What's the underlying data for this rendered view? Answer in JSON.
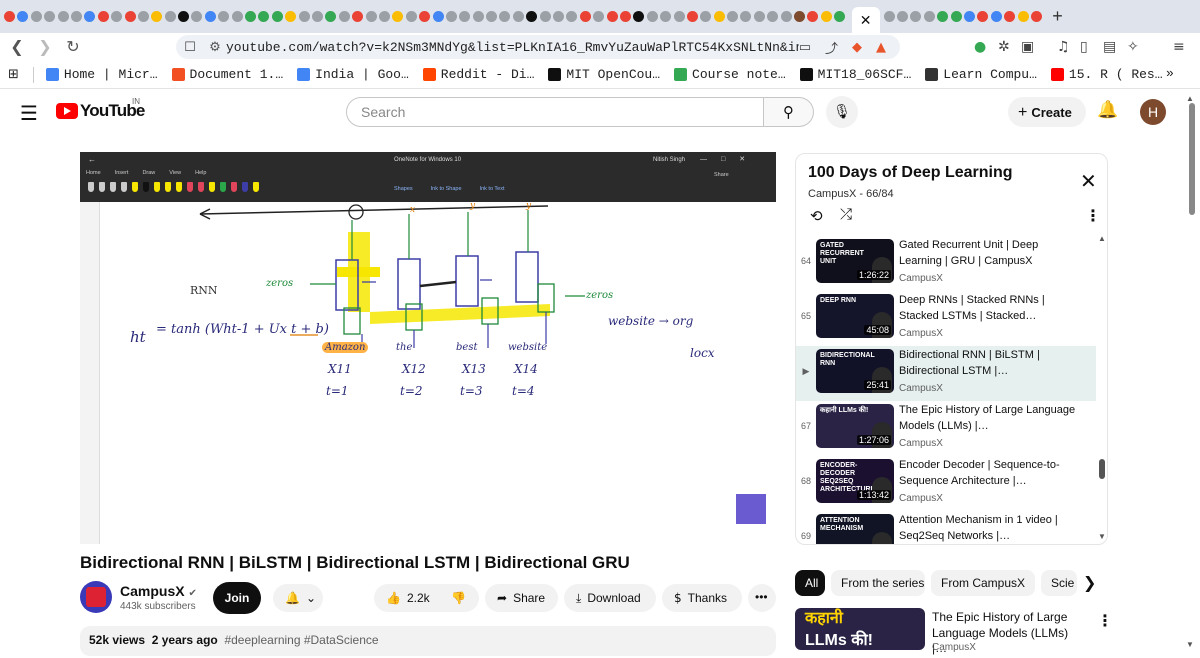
{
  "browser": {
    "tab_favicon_colors": [
      "#ea4335",
      "#4285f4",
      "#9aa0a6",
      "#9aa0a6",
      "#9aa0a6",
      "#9aa0a6",
      "#4285f4",
      "#ea4335",
      "#9aa0a6",
      "#ea4335",
      "#9aa0a6",
      "#fbbc04",
      "#9aa0a6",
      "#0f0f0f",
      "#9aa0a6",
      "#4285f4",
      "#9aa0a6",
      "#9aa0a6",
      "#34a853",
      "#34a853",
      "#34a853",
      "#fbbc04",
      "#9aa0a6",
      "#9aa0a6",
      "#34a853",
      "#9aa0a6",
      "#ea4335",
      "#9aa0a6",
      "#9aa0a6",
      "#fbbc04",
      "#9aa0a6",
      "#ea4335",
      "#4285f4",
      "#9aa0a6",
      "#9aa0a6",
      "#9aa0a6",
      "#9aa0a6",
      "#9aa0a6",
      "#9aa0a6",
      "#0f0f0f",
      "#9aa0a6",
      "#9aa0a6",
      "#9aa0a6",
      "#ea4335",
      "#9aa0a6",
      "#ea4335",
      "#ea4335",
      "#0f0f0f",
      "#9aa0a6",
      "#9aa0a6",
      "#9aa0a6",
      "#ea4335",
      "#9aa0a6",
      "#fbbc04",
      "#9aa0a6",
      "#9aa0a6",
      "#9aa0a6",
      "#9aa0a6",
      "#9aa0a6",
      "#7d4a2e",
      "#ea4335",
      "#fbbc04",
      "#34a853"
    ],
    "tab_favicon_colors_right": [
      "#9aa0a6",
      "#9aa0a6",
      "#9aa0a6",
      "#9aa0a6",
      "#34a853",
      "#34a853",
      "#4285f4",
      "#ea4335",
      "#4285f4",
      "#ea4335",
      "#fbbc04",
      "#ea4335"
    ],
    "active_tab_close": "✕",
    "new_tab": "+",
    "url": "youtube.com/watch?v=k2NSm3MNdYg&list=PLKnIA16_RmvYuZauWaPlRTC54KxSNLtNn&index=66",
    "bookmarks": [
      {
        "label": "Home | Micr…",
        "color": "#4285f4"
      },
      {
        "label": "Document 1.…",
        "color": "#f25022"
      },
      {
        "label": "India | Goo…",
        "color": "#4285f4"
      },
      {
        "label": "Reddit - Di…",
        "color": "#ff4500"
      },
      {
        "label": "MIT OpenCou…",
        "color": "#0f0f0f"
      },
      {
        "label": "Course note…",
        "color": "#34a853"
      },
      {
        "label": "MIT18_06SCF…",
        "color": "#0f0f0f"
      },
      {
        "label": "Learn Compu…",
        "color": "#333333"
      },
      {
        "label": "15. R ( Res…",
        "color": "#ff0000"
      }
    ],
    "bookmarks_more": "»"
  },
  "header": {
    "logo_text": "YouTube",
    "country": "IN",
    "search_placeholder": "Search",
    "create_label": "Create",
    "avatar_letter": "H"
  },
  "player": {
    "app_title": "OneNote for Windows 10",
    "user": "Nitish Singh",
    "ribbon_tabs": [
      "Home",
      "Insert",
      "Draw",
      "View",
      "Help"
    ],
    "tools": [
      "Shapes",
      "Ink to Shape",
      "Ink to Text"
    ],
    "share": "Share",
    "notes": {
      "rnn": "RNN",
      "zeros_left": "zeros",
      "zeros_right": "zeros",
      "eq_h": "ht",
      "eq": "= tanh (Wht-1 + Ux t + b)",
      "words": [
        "Amazon",
        "the",
        "best",
        "website"
      ],
      "inputs": [
        "X11",
        "X12",
        "X13",
        "X14"
      ],
      "steps": [
        "t=1",
        "t=2",
        "t=3",
        "t=4"
      ],
      "right1": "website → org",
      "right2": "locx"
    }
  },
  "video": {
    "title": "Bidirectional RNN | BiLSTM | Bidirectional LSTM | Bidirectional GRU",
    "channel": "CampusX",
    "verified": "✔",
    "subscribers": "443k subscribers",
    "join": "Join",
    "likes": "2.2k",
    "share": "Share",
    "download": "Download",
    "thanks": "Thanks",
    "views": "52k views",
    "age": "2 years ago",
    "tags": "#deeplearning #DataScience"
  },
  "playlist": {
    "title": "100 Days of Deep Learning",
    "subtitle": "CampusX - 66/84",
    "items": [
      {
        "index": "64",
        "title": "Gated Recurrent Unit | Deep Learning | GRU | CampusX",
        "channel": "CampusX",
        "duration": "1:26:22",
        "thumb_text": "GATED RECURRENT UNIT",
        "bg": "#10101c"
      },
      {
        "index": "65",
        "title": "Deep RNNs | Stacked RNNs | Stacked LSTMs | Stacked…",
        "channel": "CampusX",
        "duration": "45:08",
        "thumb_text": "DEEP RNN",
        "bg": "#14142a"
      },
      {
        "index": "▶",
        "title": "Bidirectional RNN | BiLSTM | Bidirectional LSTM |…",
        "channel": "CampusX",
        "duration": "25:41",
        "thumb_text": "BIDIRECTIONAL RNN",
        "bg": "#111128",
        "active": true
      },
      {
        "index": "67",
        "title": "The Epic History of Large Language Models (LLMs) |…",
        "channel": "CampusX",
        "duration": "1:27:06",
        "thumb_text": "कहानी LLMs की!",
        "bg": "#2a2345"
      },
      {
        "index": "68",
        "title": "Encoder Decoder | Sequence-to-Sequence Architecture |…",
        "channel": "CampusX",
        "duration": "1:13:42",
        "thumb_text": "ENCODER-DECODER SEQ2SEQ ARCHITECTURE",
        "bg": "#1b1030"
      },
      {
        "index": "69",
        "title": "Attention Mechanism in 1 video | Seq2Seq Networks |…",
        "channel": "CampusX",
        "duration": "41:21",
        "thumb_text": "ATTENTION MECHANISM",
        "bg": "#101424"
      }
    ]
  },
  "chips": [
    "All",
    "From the series",
    "From CampusX",
    "Scie"
  ],
  "recommendation": {
    "title": "The Epic History of Large Language Models (LLMs) |…",
    "channel": "CampusX",
    "thumb_line1": "कहानी",
    "thumb_line2": "LLMs की!"
  }
}
